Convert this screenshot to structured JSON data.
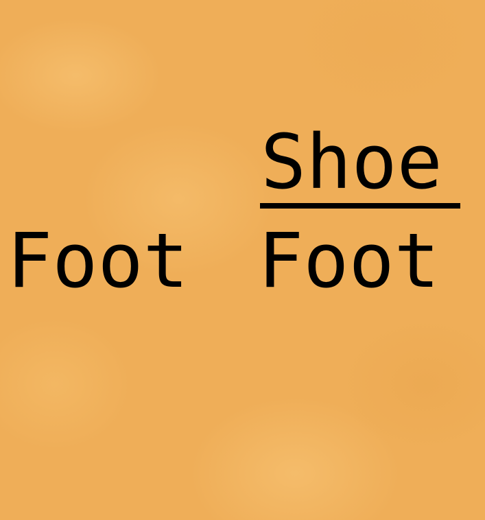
{
  "left_word": "Foot",
  "fraction": {
    "numerator": "Shoe",
    "denominator": "Foot"
  },
  "colors": {
    "background": "#efae58",
    "text": "#000000"
  }
}
